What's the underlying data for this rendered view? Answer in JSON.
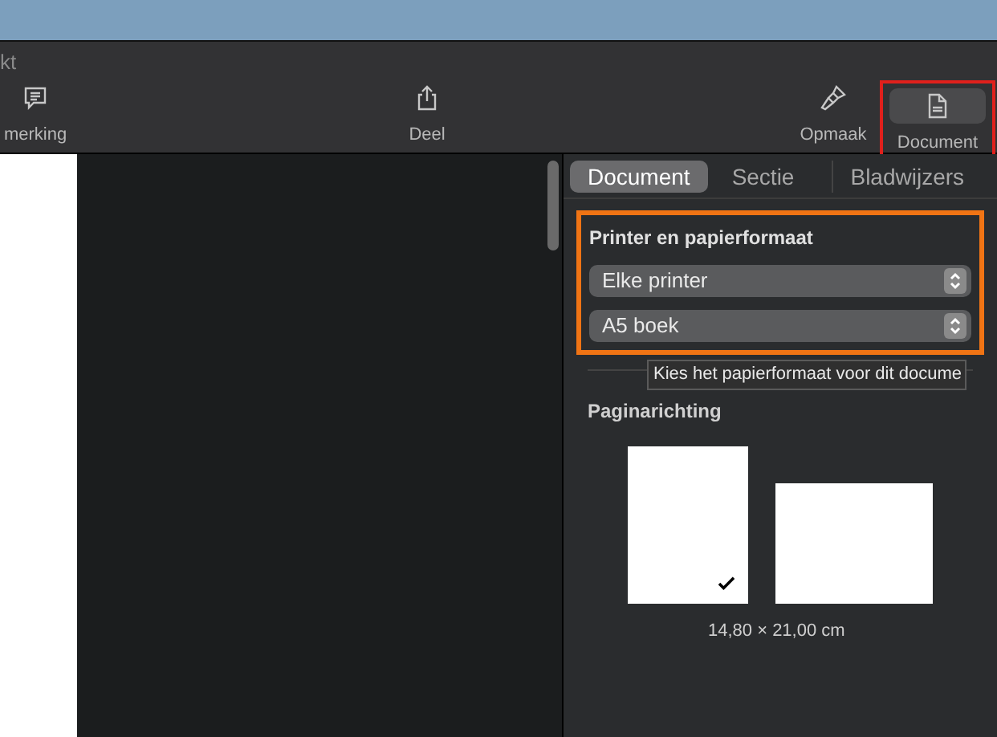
{
  "window": {
    "title": "kt"
  },
  "toolbar": [
    {
      "kind": "comment",
      "label": "merking",
      "selected": false
    },
    {
      "kind": "share",
      "label": "Deel",
      "selected": false
    },
    {
      "kind": "format",
      "label": "Opmaak",
      "selected": false
    },
    {
      "kind": "document",
      "label": "Document",
      "selected": true
    }
  ],
  "tabs": [
    {
      "label": "Document",
      "selected": true
    },
    {
      "label": "Sectie",
      "selected": false
    },
    {
      "label": "Bladwijzers",
      "selected": false
    }
  ],
  "printer_section": {
    "title": "Printer en papierformaat",
    "printer": "Elke printer",
    "paper": "A5 boek"
  },
  "tooltip": "Kies het papierformaat voor dit docume",
  "orientation": {
    "title": "Paginarichting",
    "options": [
      {
        "kind": "portrait",
        "selected": true
      },
      {
        "kind": "landscape",
        "selected": false
      }
    ],
    "size": "14,80 × 21,00 cm"
  }
}
